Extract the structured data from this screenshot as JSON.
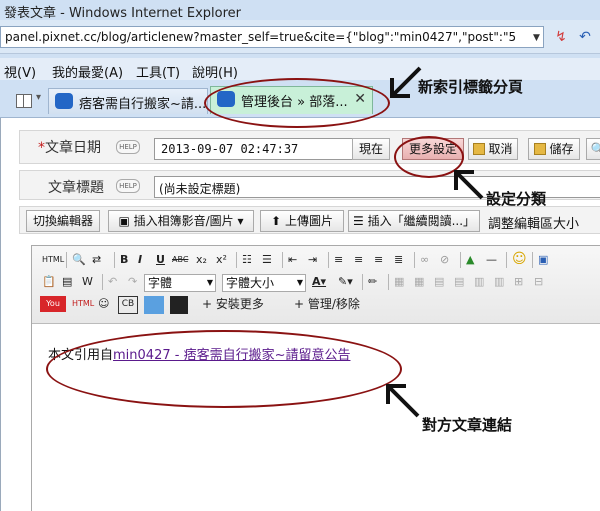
{
  "window": {
    "title": "發表文章 - Windows Internet Explorer"
  },
  "address_bar": {
    "url": "panel.pixnet.cc/blog/articlenew?master_self=true&cite={\"blog\":\"min0427\",\"post\":\"5"
  },
  "menu": {
    "items": [
      "視(V)",
      "我的最愛(A)",
      "工具(T)",
      "說明(H)"
    ]
  },
  "tabs": [
    {
      "label": "痞客需自行搬家~請..."
    },
    {
      "label": "管理後台 » 部落..."
    }
  ],
  "form": {
    "date_label": "文章日期",
    "date_required_mark": "*",
    "date_value": "2013-09-07 02:47:37",
    "help_text": "HELP",
    "title_label": "文章標題",
    "title_value": "(尚未設定標題)",
    "buttons": {
      "now": "現在",
      "more_settings": "更多設定",
      "cancel": "取消",
      "save": "儲存"
    }
  },
  "editor_toolbar": {
    "switch_editor": "切換編輯器",
    "insert_media": "插入相簿影音/圖片",
    "upload_image": "上傳圖片",
    "insert_readmore": "插入「繼續閱讀...」",
    "resize_editor": "調整編輯區大小",
    "font_face": "字體",
    "font_size": "字體大小",
    "install_more": "安裝更多",
    "manage_remove": "管理/移除"
  },
  "editor_content": {
    "prefix": "本文引用自",
    "link_text": "min0427 - 痞客需自行搬家~請留意公告"
  },
  "annotations": {
    "new_tab": "新索引標籤分頁",
    "settings_tab": "設定分類",
    "article_link": "對方文章連結"
  },
  "colors": {
    "annotation_ellipse": "#8a1212",
    "active_tab": "#c8f0d8",
    "link": "#5a1a8c"
  }
}
